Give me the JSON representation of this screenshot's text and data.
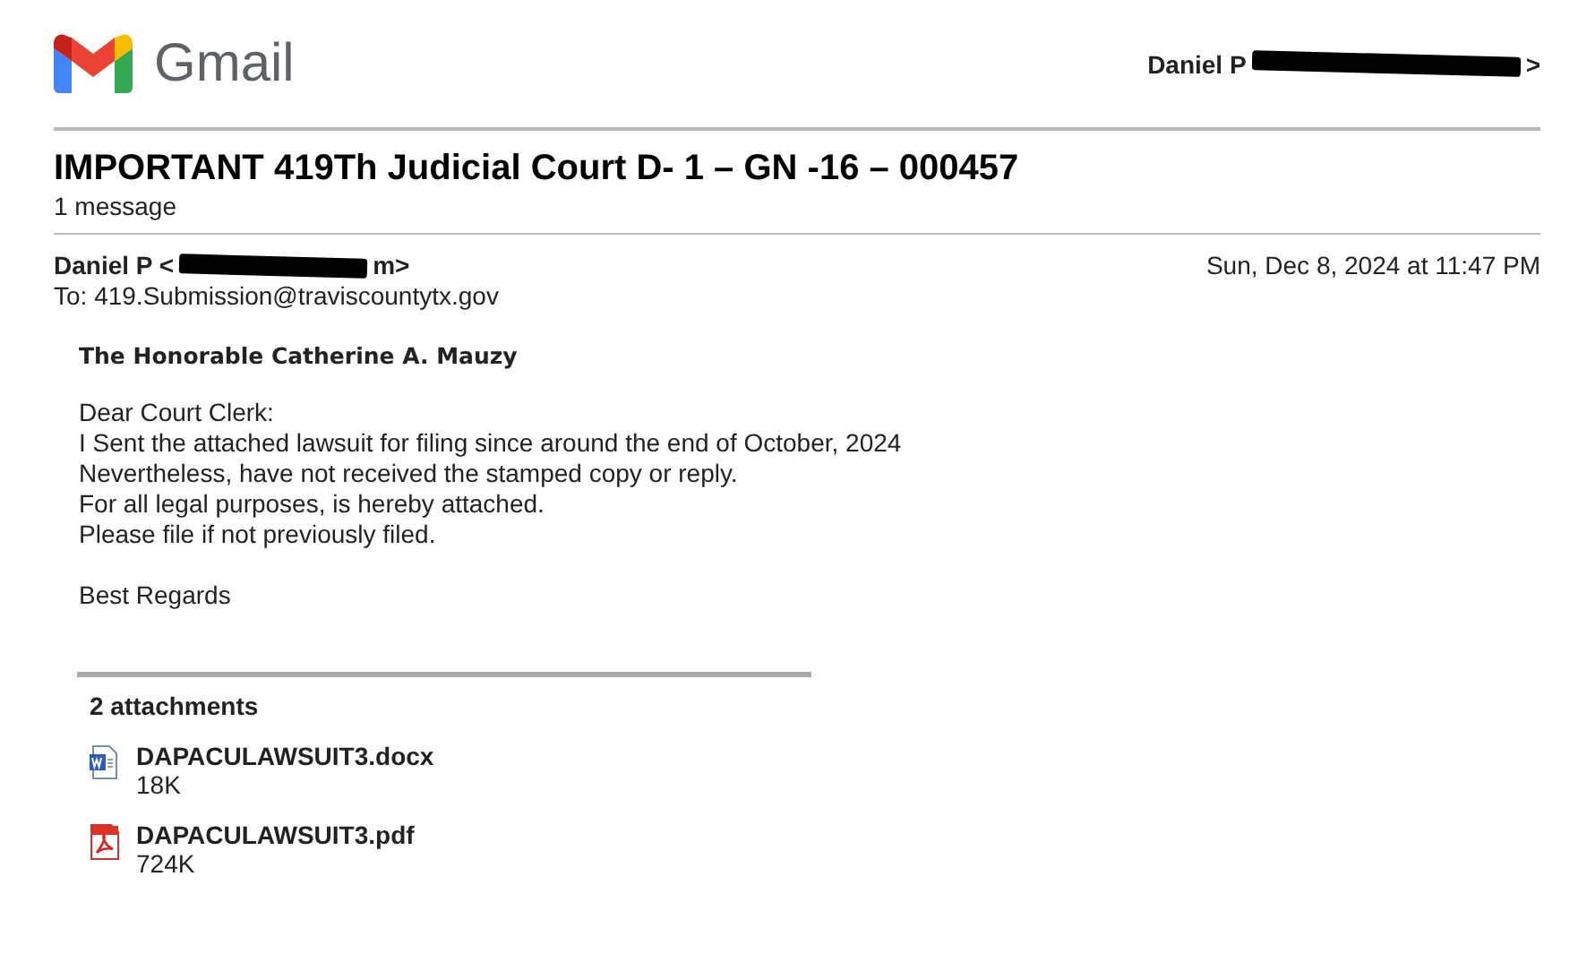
{
  "header": {
    "brand": "Gmail",
    "account_name": "Daniel P",
    "account_tail": ">"
  },
  "thread": {
    "subject": "IMPORTANT 419Th Judicial Court D- 1 – GN -16 – 000457",
    "count": "1 message"
  },
  "message": {
    "sender_name": "Daniel P",
    "sender_open": "<",
    "sender_tail": "m>",
    "date": "Sun, Dec 8, 2024 at 11:47 PM",
    "to": "To: 419.Submission@traviscountytx.gov",
    "salutation_heading": "The Honorable Catherine A. Mauzy",
    "body_lines": [
      "Dear Court Clerk:",
      "I Sent the attached lawsuit for filing since around the end of October, 2024",
      "Nevertheless, have not received the stamped copy or reply.",
      "For all legal purposes, is hereby attached.",
      "Please file if not previously filed."
    ],
    "closing": "Best Regards"
  },
  "attachments": {
    "heading": "2 attachments",
    "items": [
      {
        "kind": "word",
        "name": "DAPACULAWSUIT3.docx",
        "size": "18K"
      },
      {
        "kind": "pdf",
        "name": "DAPACULAWSUIT3.pdf",
        "size": "724K"
      }
    ]
  }
}
